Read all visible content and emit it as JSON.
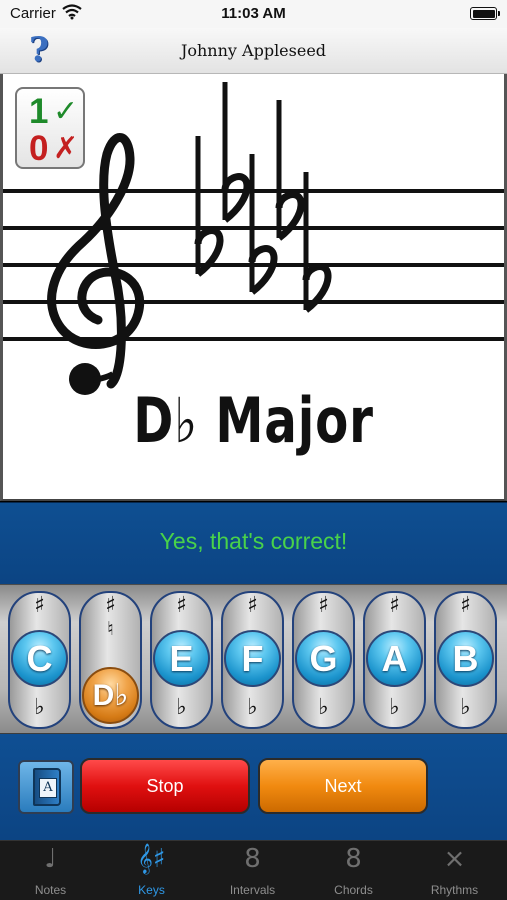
{
  "status_bar": {
    "carrier": "Carrier",
    "time": "11:03 AM"
  },
  "nav": {
    "help_icon": "?",
    "title": "Johnny Appleseed"
  },
  "score": {
    "correct": "1",
    "correct_mark": "✓",
    "wrong": "0",
    "wrong_mark": "✗"
  },
  "exercise": {
    "key_name": "D♭ Major",
    "flats_in_signature": 5
  },
  "feedback": {
    "message": "Yes, that's correct!",
    "color": "#49d24a"
  },
  "keys": [
    {
      "label": "C",
      "sharp": "♯",
      "natural": "",
      "flat": "♭",
      "selected": false
    },
    {
      "label": "D♭",
      "sharp": "♯",
      "natural": "♮",
      "flat": "",
      "selected": true
    },
    {
      "label": "E",
      "sharp": "♯",
      "natural": "",
      "flat": "♭",
      "selected": false
    },
    {
      "label": "F",
      "sharp": "♯",
      "natural": "",
      "flat": "♭",
      "selected": false
    },
    {
      "label": "G",
      "sharp": "♯",
      "natural": "",
      "flat": "♭",
      "selected": false
    },
    {
      "label": "A",
      "sharp": "♯",
      "natural": "",
      "flat": "♭",
      "selected": false
    },
    {
      "label": "B",
      "sharp": "♯",
      "natural": "",
      "flat": "♭",
      "selected": false
    }
  ],
  "controls": {
    "book_letter": "A",
    "stop_label": "Stop",
    "next_label": "Next"
  },
  "tabs": [
    {
      "label": "Notes",
      "icon": "♩",
      "active": false
    },
    {
      "label": "Keys",
      "icon": "𝄞♯",
      "active": true
    },
    {
      "label": "Intervals",
      "icon": "8",
      "active": false
    },
    {
      "label": "Chords",
      "icon": "8",
      "active": false
    },
    {
      "label": "Rhythms",
      "icon": "×",
      "active": false
    }
  ],
  "colors": {
    "accent_blue": "#0e4f92",
    "tab_active": "#2f98e6",
    "stop": "#e01010",
    "next": "#f18a10"
  }
}
